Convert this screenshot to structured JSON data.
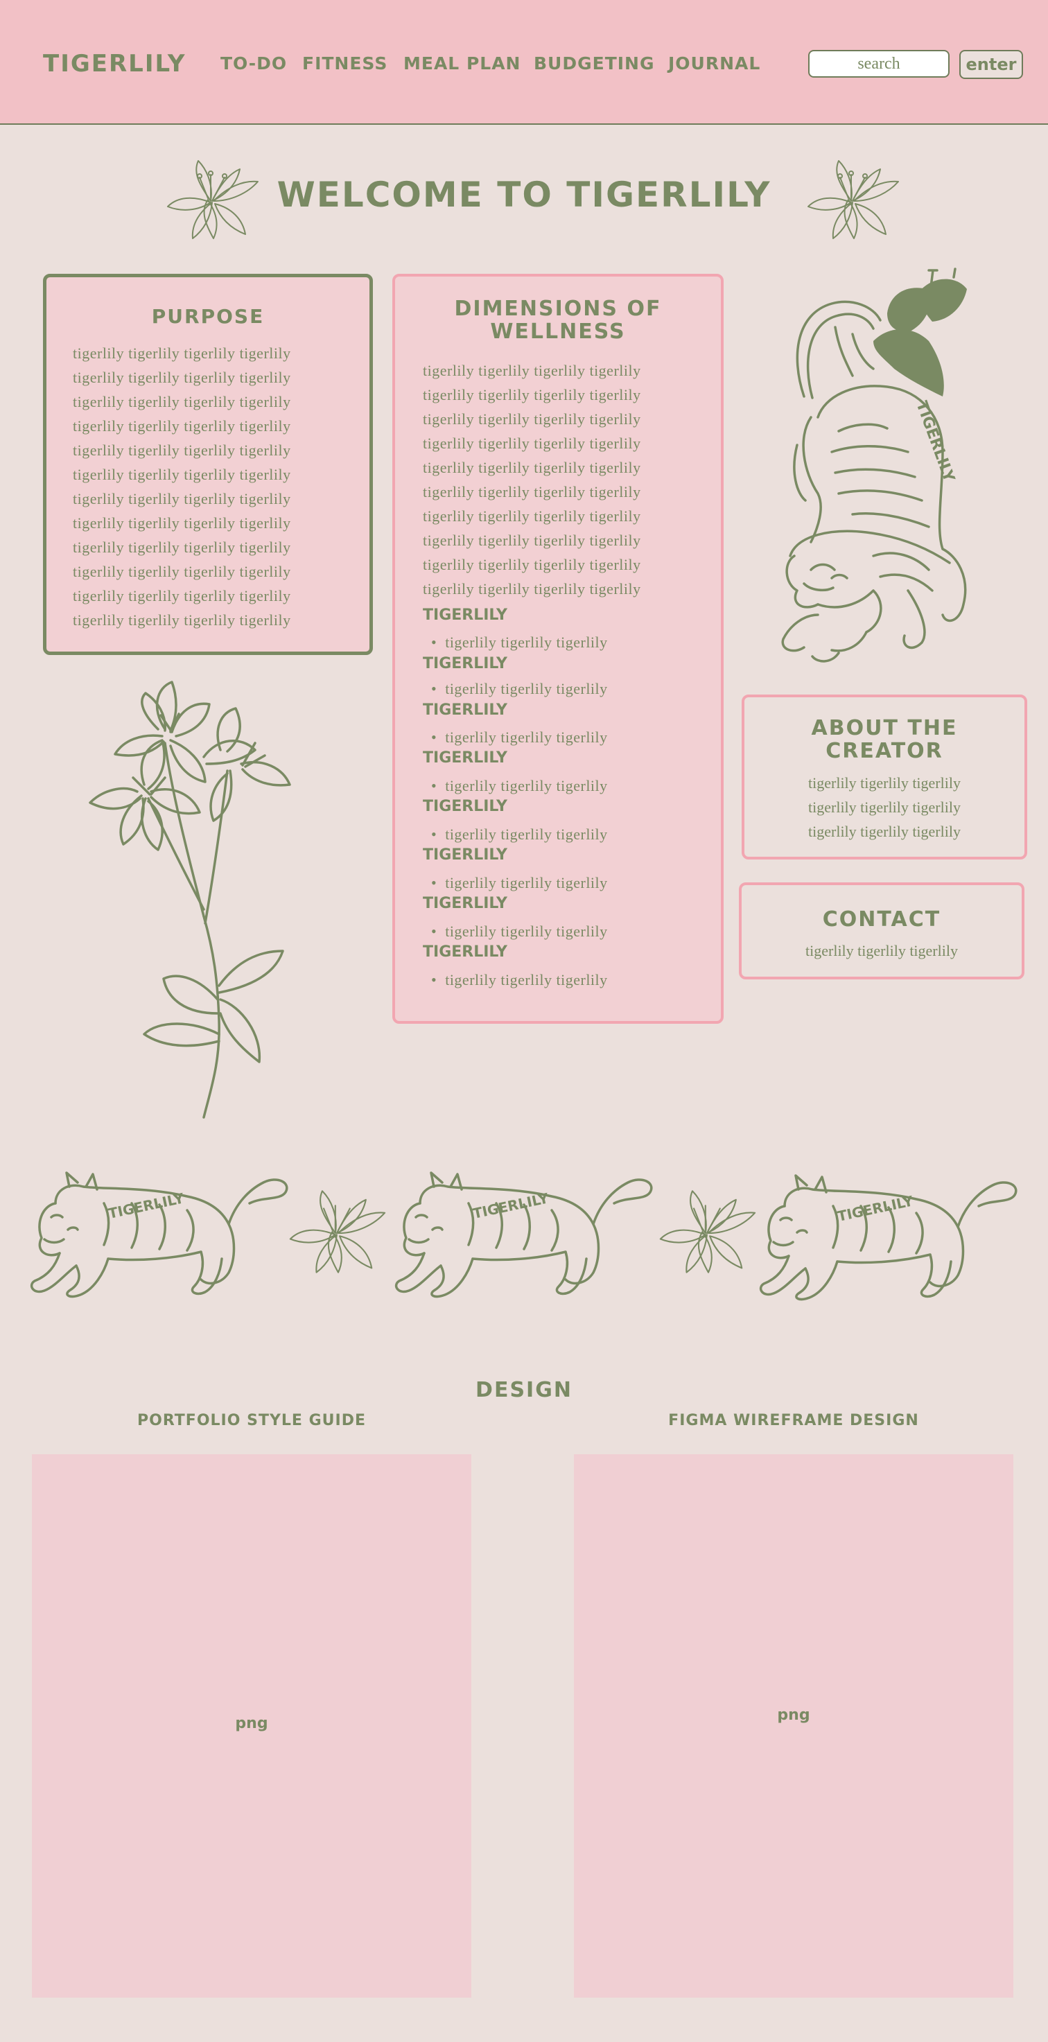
{
  "header": {
    "brand": "TIGERLILY",
    "nav": [
      "TO-DO",
      "FITNESS",
      "MEAL PLAN",
      "BUDGETING",
      "JOURNAL"
    ],
    "search_placeholder": "search",
    "enter_label": "enter"
  },
  "welcome": {
    "title": "WELCOME TO TIGERLILY"
  },
  "purpose": {
    "title": "PURPOSE",
    "lines": [
      "tigerlily tigerlily tigerlily tigerlily",
      "tigerlily tigerlily tigerlily tigerlily",
      "tigerlily tigerlily tigerlily tigerlily",
      "tigerlily tigerlily tigerlily tigerlily",
      "tigerlily tigerlily tigerlily tigerlily",
      "tigerlily tigerlily tigerlily tigerlily",
      "tigerlily tigerlily tigerlily tigerlily",
      "tigerlily tigerlily tigerlily tigerlily",
      "tigerlily tigerlily tigerlily tigerlily",
      "tigerlily tigerlily tigerlily tigerlily",
      "tigerlily tigerlily tigerlily tigerlily",
      "tigerlily tigerlily tigerlily tigerlily"
    ]
  },
  "dimensions": {
    "title_line1": "DIMENSIONS OF",
    "title_line2": "WELLNESS",
    "lines": [
      "tigerlily tigerlily tigerlily tigerlily",
      "tigerlily tigerlily tigerlily tigerlily",
      "tigerlily tigerlily tigerlily tigerlily",
      "tigerlily tigerlily tigerlily tigerlily",
      "tigerlily tigerlily tigerlily tigerlily",
      "tigerlily tigerlily tigerlily tigerlily",
      "tigerlily tigerlily tigerlily tigerlily",
      "tigerlily tigerlily tigerlily tigerlily",
      "tigerlily tigerlily tigerlily tigerlily",
      "tigerlily tigerlily tigerlily tigerlily"
    ],
    "items": [
      {
        "heading": "TIGERLILY",
        "bullet": "tigerlily tigerlily tigerlily"
      },
      {
        "heading": "TIGERLILY",
        "bullet": "tigerlily tigerlily tigerlily"
      },
      {
        "heading": "TIGERLILY",
        "bullet": "tigerlily tigerlily tigerlily"
      },
      {
        "heading": "TIGERLILY",
        "bullet": "tigerlily tigerlily tigerlily"
      },
      {
        "heading": "TIGERLILY",
        "bullet": "tigerlily tigerlily tigerlily"
      },
      {
        "heading": "TIGERLILY",
        "bullet": "tigerlily tigerlily tigerlily"
      },
      {
        "heading": "TIGERLILY",
        "bullet": "tigerlily tigerlily tigerlily"
      },
      {
        "heading": "TIGERLILY",
        "bullet": "tigerlily tigerlily tigerlily"
      }
    ]
  },
  "about": {
    "title_line1": "ABOUT THE",
    "title_line2": "CREATOR",
    "lines": [
      "tigerlily tigerlily tigerlily",
      "tigerlily tigerlily tigerlily",
      "tigerlily tigerlily tigerlily"
    ]
  },
  "contact": {
    "title": "CONTACT",
    "line": "tigerlily tigerlily tigerlily"
  },
  "illustrations": {
    "tiger_text": "TIGERLILY"
  },
  "design": {
    "title": "DESIGN",
    "left_title": "PORTFOLIO STYLE GUIDE",
    "right_title": "FIGMA WIREFRAME DESIGN",
    "left_placeholder": "png",
    "right_placeholder": "png"
  },
  "colors": {
    "header_bg": "#f2c1c6",
    "page_bg": "#ebe0dc",
    "sage": "#7a8a63",
    "pink_border": "#f2a6b1",
    "card_bg": "#f2d0d3"
  },
  "icons": [
    "lily-icon",
    "tiger-icon",
    "lily-bouquet-icon",
    "walking-tiger-icon"
  ]
}
